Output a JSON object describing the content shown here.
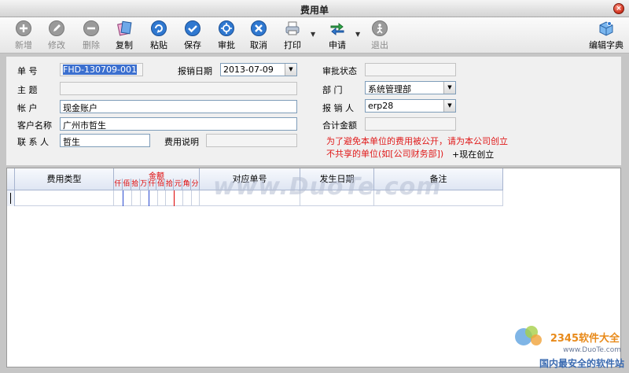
{
  "window": {
    "title": "费用单",
    "close_glyph": "×"
  },
  "toolbar": {
    "buttons": [
      {
        "label": "新增",
        "icon": "plus-circle-icon",
        "enabled": false
      },
      {
        "label": "修改",
        "icon": "pencil-circle-icon",
        "enabled": false
      },
      {
        "label": "删除",
        "icon": "minus-circle-icon",
        "enabled": false
      },
      {
        "label": "复制",
        "icon": "copy-icon",
        "enabled": true
      },
      {
        "label": "粘贴",
        "icon": "paste-icon",
        "enabled": true
      },
      {
        "label": "保存",
        "icon": "check-circle-icon",
        "enabled": true
      },
      {
        "label": "审批",
        "icon": "approve-icon",
        "enabled": true
      },
      {
        "label": "取消",
        "icon": "cancel-icon",
        "enabled": true
      },
      {
        "label": "打印",
        "icon": "printer-icon",
        "enabled": true
      },
      {
        "label": "申请",
        "icon": "apply-arrows-icon",
        "enabled": true
      },
      {
        "label": "退出",
        "icon": "exit-icon",
        "enabled": false
      },
      {
        "label": "编辑字典",
        "icon": "dictionary-icon",
        "enabled": true
      }
    ],
    "dropdown_caret": "▼"
  },
  "form": {
    "doc_no": {
      "label": "单    号",
      "value": "FHD-130709-001"
    },
    "claim_date": {
      "label": "报销日期",
      "value": "2013-07-09"
    },
    "subject": {
      "label": "主    题",
      "value": ""
    },
    "account": {
      "label": "帐    户",
      "value": "现金账户"
    },
    "customer": {
      "label": "客户名称",
      "value": "广州市哲生"
    },
    "contact": {
      "label": "联 系 人",
      "value": "哲生"
    },
    "expense_note": {
      "label": "费用说明",
      "value": ""
    },
    "approval_status": {
      "label": "审批状态",
      "value": ""
    },
    "department": {
      "label": "部    门",
      "value": "系统管理部"
    },
    "claimant": {
      "label": "报 销 人",
      "value": "erp28"
    },
    "total_amount": {
      "label": "合计金额",
      "value": ""
    },
    "warning_line1": "为了避免本单位的费用被公开，请为本公司创立",
    "warning_line2": "不共享的单位(如[公司财务部])",
    "create_link": "+现在创立"
  },
  "grid": {
    "columns": {
      "type": "费用类型",
      "amount": "金额",
      "ref_no": "对应单号",
      "date": "发生日期",
      "remark": "备注"
    },
    "amount_digits": [
      "仟",
      "佰",
      "拾",
      "万",
      "仟",
      "佰",
      "拾",
      "元",
      "角",
      "分"
    ]
  },
  "watermark": {
    "center": "www.DuoTe.com",
    "logo": "2345软件大全",
    "url": "www.DuoTe.com",
    "slogan": "国内最安全的软件站"
  }
}
